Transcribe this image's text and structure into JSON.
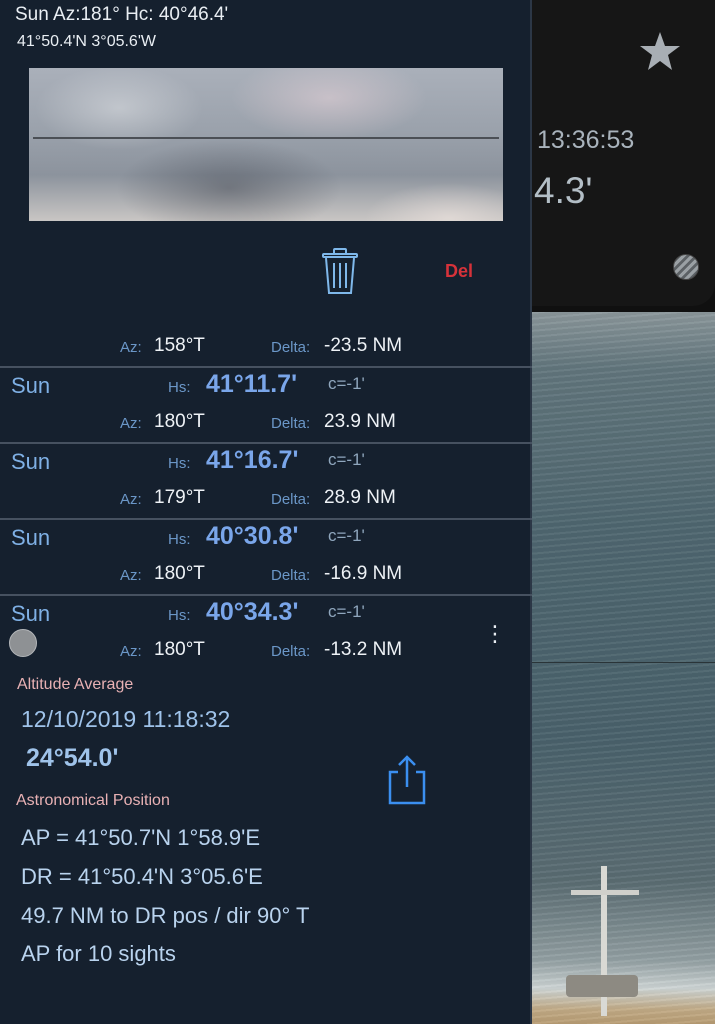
{
  "header": {
    "line1": "Sun  Az:181° Hc: 40°46.4'",
    "line2": "41°50.4'N  3°05.6'W"
  },
  "toolbar": {
    "delete_label": "Del"
  },
  "side": {
    "time": "13:36:53",
    "reading": "4.3'"
  },
  "partial_row": {
    "az_value": "158°T",
    "delta_value": "-23.5 NM"
  },
  "labels": {
    "hs": "Hs:",
    "az": "Az:",
    "delta": "Delta:"
  },
  "sights": [
    {
      "body": "Sun",
      "hs": "41°11.7'",
      "c": "c=-1'",
      "az": "180°T",
      "delta": "23.9 NM"
    },
    {
      "body": "Sun",
      "hs": "41°16.7'",
      "c": "c=-1'",
      "az": "179°T",
      "delta": "28.9 NM"
    },
    {
      "body": "Sun",
      "hs": "40°30.8'",
      "c": "c=-1'",
      "az": "180°T",
      "delta": "-16.9 NM"
    },
    {
      "body": "Sun",
      "hs": "40°34.3'",
      "c": "c=-1'",
      "az": "180°T",
      "delta": "-13.2 NM"
    }
  ],
  "altitude_average": {
    "label": "Altitude Average",
    "datetime": "12/10/2019 11:18:32",
    "value": "24°54.0'"
  },
  "astro_position": {
    "label": "Astronomical Position",
    "ap": "AP  = 41°50.7'N   1°58.9'E",
    "dr": "DR = 41°50.4'N   3°05.6'E",
    "distance": "49.7 NM to DR pos / dir 90° T",
    "count": "AP for 10 sights"
  },
  "icons": {
    "star": "star-icon",
    "trash": "trash-icon",
    "share": "share-icon",
    "more": "more-icon"
  },
  "colors": {
    "panel_bg": "#15202e",
    "accent_blue": "#7aa6ea",
    "section_pink": "#e8b1b4",
    "delete_red": "#d6323a"
  }
}
